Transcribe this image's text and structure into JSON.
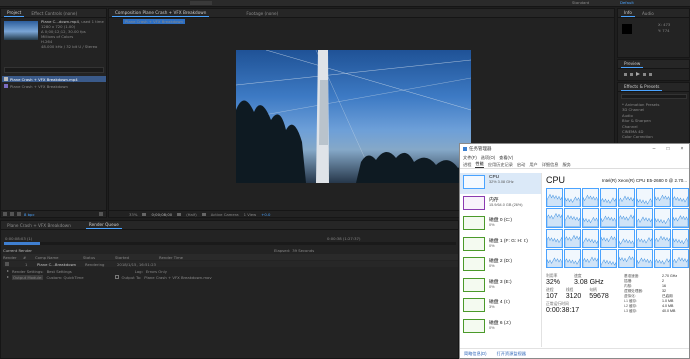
{
  "ae": {
    "top_bar": {
      "workspace": "Standard",
      "workspace_alt": "Default"
    },
    "project_panel": {
      "tabs": [
        "Project",
        "Effect Controls (none)"
      ],
      "footage_name": "Plane C...down.mp4",
      "footage_used": ", used 1 time",
      "footage_info": [
        "1280 x 720 (1.00)",
        "Δ 0;00;12;12, 30.00 fps",
        "Millions of Colors",
        "H.264",
        "48.000 kHz / 32 bit U / Stereo"
      ],
      "items": [
        "Plane Crash + VFX Breakdown.mp4",
        "Plane Crash + VFX Breakdown"
      ],
      "bpc": "8 bpc"
    },
    "viewer": {
      "tabs": [
        "Composition Plane Crash + VFX Breakdown",
        "Footage (none)"
      ],
      "comp_chip": "Plane Crash + VFX Breakdown",
      "zoom": "33%",
      "timecode": "0;00;08;00",
      "resolution": "(Half)",
      "camera": "Active Camera",
      "views": "1 View",
      "exposure": "+0.0"
    },
    "right_panels": {
      "info_tabs": [
        "Info",
        "Audio"
      ],
      "info_values": [
        "X: 473",
        "Y: 774"
      ],
      "preview_tab": "Preview",
      "effects_tab": "Effects & Presets",
      "effects_items": [
        "* Animation Presets",
        "3D Channel",
        "Audio",
        "Blur & Sharpen",
        "Channel",
        "CINEMA 4D",
        "Color Correction"
      ]
    },
    "render_queue": {
      "tabs": [
        "Plane Crash + VFX Breakdown",
        "Render Queue"
      ],
      "elapsed_label": "Elapsed:",
      "elapsed_value": "39 Seconds",
      "remaining": "0:00:38 (1:27:37)",
      "time_left": "0:00:08:03 (1)",
      "current_render": "Current Render",
      "columns": [
        "Render",
        "#",
        "Comp Name",
        "Status",
        "Started",
        "Render Time"
      ],
      "row": {
        "num": "1",
        "comp": "Plane C...Breakdown",
        "status": "Rendering",
        "started": "2018/1/15, 16:51:23"
      },
      "render_settings_label": "Render Settings:",
      "render_settings_value": "Best Settings",
      "log_label": "Log:",
      "log_value": "Errors Only",
      "output_module_label": "Output Module:",
      "output_module_value": "Custom: QuickTime",
      "output_to_label": "Output To:",
      "output_to_value": "Plane Crash + VFX Breakdown.mov"
    }
  },
  "taskmgr": {
    "title": "任务管理器",
    "menu": [
      "文件(F)",
      "选项(O)",
      "查看(V)"
    ],
    "tabs": [
      "进程",
      "性能",
      "应用历史记录",
      "启动",
      "用户",
      "详细信息",
      "服务"
    ],
    "resources": [
      {
        "name": "CPU",
        "sub": "32%  3.08 GHz",
        "kind": "cpu"
      },
      {
        "name": "内存",
        "sub": "15.9/64.0 GB (26%)",
        "kind": "mem"
      },
      {
        "name": "磁盘 0 (C:)",
        "sub": "0%",
        "kind": "disk"
      },
      {
        "name": "磁盘 1 (F: G: H: I:)",
        "sub": "0%",
        "kind": "disk"
      },
      {
        "name": "磁盘 2 (D:)",
        "sub": "0%",
        "kind": "disk"
      },
      {
        "name": "磁盘 3 (E:)",
        "sub": "0%",
        "kind": "disk"
      },
      {
        "name": "磁盘 4 (I:)",
        "sub": "3%",
        "kind": "disk"
      },
      {
        "name": "磁盘 6 (J:)",
        "sub": "0%",
        "kind": "disk"
      }
    ],
    "detail_title": "CPU",
    "detail_model": "Intel(R) Xeon(R) CPU E5-2680 0 @ 2.70...",
    "graph_top_pct": "100%",
    "core_levels": [
      0.55,
      0.4,
      0.5,
      0.35,
      0.45,
      0.3,
      0.5,
      0.42,
      0.6,
      0.5,
      0.38,
      0.45,
      0.52,
      0.4,
      0.33,
      0.48,
      0.45,
      0.55,
      0.4,
      0.5,
      0.35,
      0.42,
      0.5,
      0.38,
      0.4,
      0.35,
      0.45,
      0.3,
      0.5,
      0.4,
      0.36,
      0.44
    ],
    "stats": {
      "util_label": "利用率",
      "util_value": "32%",
      "speed_label": "速度",
      "speed_value": "3.08 GHz",
      "proc_label": "进程",
      "proc_value": "107",
      "threads_label": "线程",
      "threads_value": "3120",
      "handles_label": "句柄",
      "handles_value": "59678",
      "uptime_label": "正常运行时间",
      "uptime_value": "0:00:38:17"
    },
    "specs": [
      {
        "k": "基准速度:",
        "v": "2.70 GHz"
      },
      {
        "k": "插槽:",
        "v": "2"
      },
      {
        "k": "内核:",
        "v": "16"
      },
      {
        "k": "逻辑处理器:",
        "v": "32"
      },
      {
        "k": "虚拟化:",
        "v": "已启用"
      },
      {
        "k": "L1 缓存:",
        "v": "1.0 MB"
      },
      {
        "k": "L2 缓存:",
        "v": "4.0 MB"
      },
      {
        "k": "L3 缓存:",
        "v": "40.0 MB"
      }
    ],
    "footer": {
      "less": "简略信息(D)",
      "monitor": "打开资源监视器"
    }
  }
}
